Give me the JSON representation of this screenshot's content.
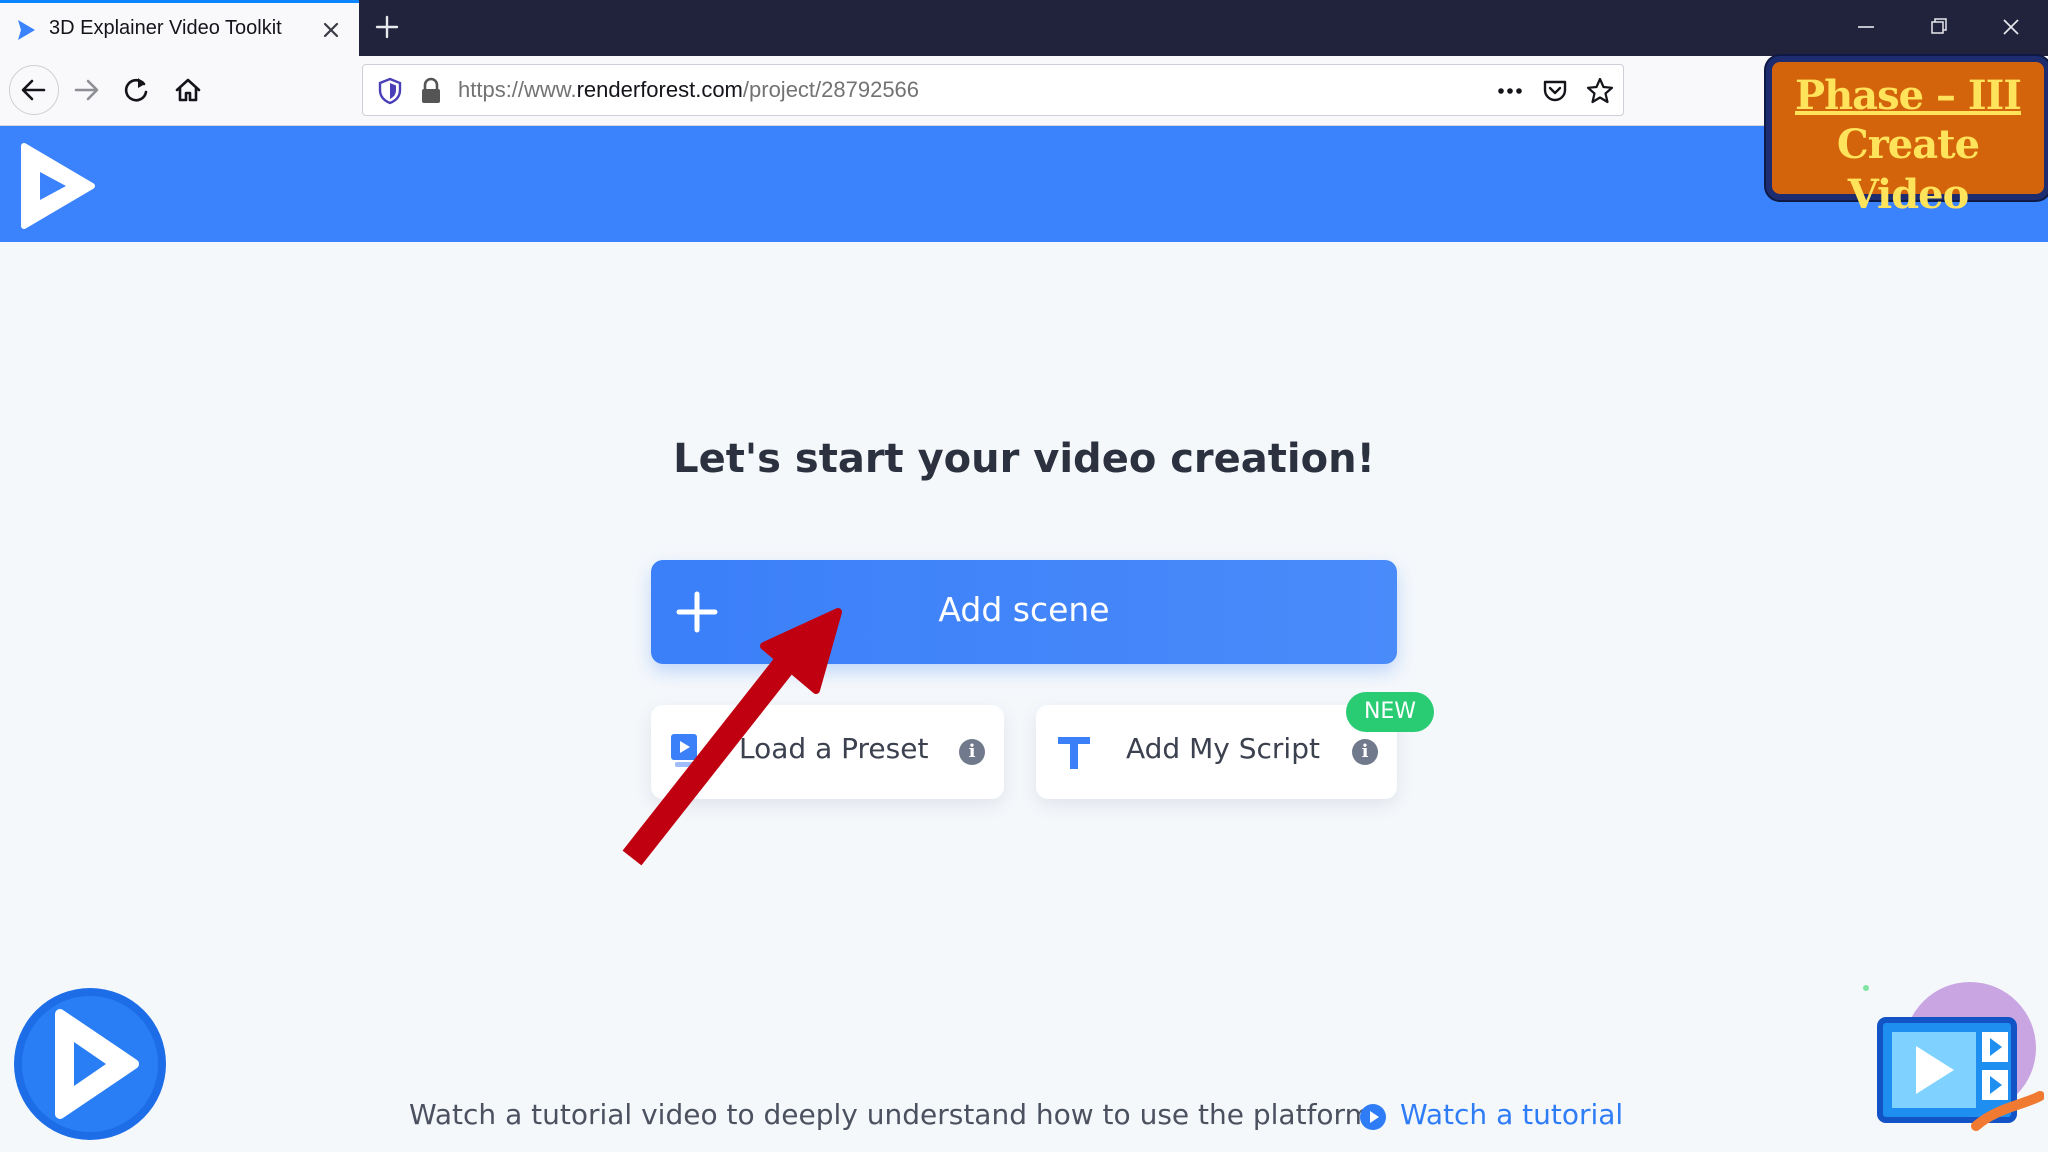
{
  "browser": {
    "tab_title": "3D Explainer Video Toolkit",
    "url_prefix": "https://www.",
    "url_domain": "renderforest.com",
    "url_path": "/project/28792566"
  },
  "overlay": {
    "phase_title": "Phase – III",
    "phase_subtitle": "Create Video"
  },
  "main": {
    "headline": "Let's start your video creation!",
    "add_scene_label": "Add scene",
    "load_preset_label": "Load a Preset",
    "add_script_label": "Add My Script",
    "new_badge": "NEW"
  },
  "footer": {
    "description": "Watch a tutorial video to deeply understand how to use the platform",
    "tutorial_link": "Watch a tutorial"
  },
  "colors": {
    "header_blue": "#3b82fd",
    "primary_button": "#3b7ff9",
    "new_badge_green": "#29cc73",
    "tab_bar": "#20233b",
    "arrow_red": "#c00010",
    "badge_orange": "#d3640c"
  }
}
